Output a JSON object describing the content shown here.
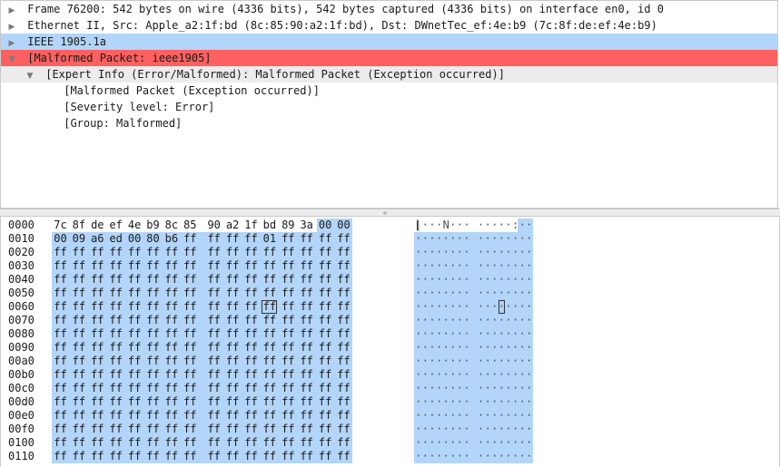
{
  "tree": [
    {
      "label": "Frame 76200: 542 bytes on wire (4336 bits), 542 bytes captured (4336 bits) on interface en0, id 0",
      "toggle": "▶",
      "indent": 0,
      "style": ""
    },
    {
      "label": "Ethernet II, Src: Apple_a2:1f:bd (8c:85:90:a2:1f:bd), Dst: DWnetTec_ef:4e:b9 (7c:8f:de:ef:4e:b9)",
      "toggle": "▶",
      "indent": 0,
      "style": ""
    },
    {
      "label": "IEEE 1905.1a",
      "toggle": "▶",
      "indent": 0,
      "style": "selected"
    },
    {
      "label": "[Malformed Packet: ieee1905]",
      "toggle": "▼",
      "indent": 0,
      "style": "error"
    },
    {
      "label": "[Expert Info (Error/Malformed): Malformed Packet (Exception occurred)]",
      "toggle": "▼",
      "indent": 1,
      "style": "expert"
    },
    {
      "label": "[Malformed Packet (Exception occurred)]",
      "toggle": "",
      "indent": 2,
      "style": ""
    },
    {
      "label": "[Severity level: Error]",
      "toggle": "",
      "indent": 2,
      "style": ""
    },
    {
      "label": "[Group: Malformed]",
      "toggle": "",
      "indent": 2,
      "style": ""
    }
  ],
  "hex_rows": [
    {
      "offset": "0000",
      "bytes": [
        "7c",
        "8f",
        "de",
        "ef",
        "4e",
        "b9",
        "8c",
        "85",
        "90",
        "a2",
        "1f",
        "bd",
        "89",
        "3a",
        "00",
        "00"
      ],
      "ascii": "|···N··· ·····:··"
    },
    {
      "offset": "0010",
      "bytes": [
        "00",
        "09",
        "a6",
        "ed",
        "00",
        "80",
        "b6",
        "ff",
        "ff",
        "ff",
        "ff",
        "01",
        "ff",
        "ff",
        "ff",
        "ff"
      ],
      "ascii": "········ ········"
    },
    {
      "offset": "0020",
      "bytes": [
        "ff",
        "ff",
        "ff",
        "ff",
        "ff",
        "ff",
        "ff",
        "ff",
        "ff",
        "ff",
        "ff",
        "ff",
        "ff",
        "ff",
        "ff",
        "ff"
      ],
      "ascii": "········ ········"
    },
    {
      "offset": "0030",
      "bytes": [
        "ff",
        "ff",
        "ff",
        "ff",
        "ff",
        "ff",
        "ff",
        "ff",
        "ff",
        "ff",
        "ff",
        "ff",
        "ff",
        "ff",
        "ff",
        "ff"
      ],
      "ascii": "········ ········"
    },
    {
      "offset": "0040",
      "bytes": [
        "ff",
        "ff",
        "ff",
        "ff",
        "ff",
        "ff",
        "ff",
        "ff",
        "ff",
        "ff",
        "ff",
        "ff",
        "ff",
        "ff",
        "ff",
        "ff"
      ],
      "ascii": "········ ········"
    },
    {
      "offset": "0050",
      "bytes": [
        "ff",
        "ff",
        "ff",
        "ff",
        "ff",
        "ff",
        "ff",
        "ff",
        "ff",
        "ff",
        "ff",
        "ff",
        "ff",
        "ff",
        "ff",
        "ff"
      ],
      "ascii": "········ ········"
    },
    {
      "offset": "0060",
      "bytes": [
        "ff",
        "ff",
        "ff",
        "ff",
        "ff",
        "ff",
        "ff",
        "ff",
        "ff",
        "ff",
        "ff",
        "ff",
        "ff",
        "ff",
        "ff",
        "ff"
      ],
      "ascii": "········ ········"
    },
    {
      "offset": "0070",
      "bytes": [
        "ff",
        "ff",
        "ff",
        "ff",
        "ff",
        "ff",
        "ff",
        "ff",
        "ff",
        "ff",
        "ff",
        "ff",
        "ff",
        "ff",
        "ff",
        "ff"
      ],
      "ascii": "········ ········"
    },
    {
      "offset": "0080",
      "bytes": [
        "ff",
        "ff",
        "ff",
        "ff",
        "ff",
        "ff",
        "ff",
        "ff",
        "ff",
        "ff",
        "ff",
        "ff",
        "ff",
        "ff",
        "ff",
        "ff"
      ],
      "ascii": "········ ········"
    },
    {
      "offset": "0090",
      "bytes": [
        "ff",
        "ff",
        "ff",
        "ff",
        "ff",
        "ff",
        "ff",
        "ff",
        "ff",
        "ff",
        "ff",
        "ff",
        "ff",
        "ff",
        "ff",
        "ff"
      ],
      "ascii": "········ ········"
    },
    {
      "offset": "00a0",
      "bytes": [
        "ff",
        "ff",
        "ff",
        "ff",
        "ff",
        "ff",
        "ff",
        "ff",
        "ff",
        "ff",
        "ff",
        "ff",
        "ff",
        "ff",
        "ff",
        "ff"
      ],
      "ascii": "········ ········"
    },
    {
      "offset": "00b0",
      "bytes": [
        "ff",
        "ff",
        "ff",
        "ff",
        "ff",
        "ff",
        "ff",
        "ff",
        "ff",
        "ff",
        "ff",
        "ff",
        "ff",
        "ff",
        "ff",
        "ff"
      ],
      "ascii": "········ ········"
    },
    {
      "offset": "00c0",
      "bytes": [
        "ff",
        "ff",
        "ff",
        "ff",
        "ff",
        "ff",
        "ff",
        "ff",
        "ff",
        "ff",
        "ff",
        "ff",
        "ff",
        "ff",
        "ff",
        "ff"
      ],
      "ascii": "········ ········"
    },
    {
      "offset": "00d0",
      "bytes": [
        "ff",
        "ff",
        "ff",
        "ff",
        "ff",
        "ff",
        "ff",
        "ff",
        "ff",
        "ff",
        "ff",
        "ff",
        "ff",
        "ff",
        "ff",
        "ff"
      ],
      "ascii": "········ ········"
    },
    {
      "offset": "00e0",
      "bytes": [
        "ff",
        "ff",
        "ff",
        "ff",
        "ff",
        "ff",
        "ff",
        "ff",
        "ff",
        "ff",
        "ff",
        "ff",
        "ff",
        "ff",
        "ff",
        "ff"
      ],
      "ascii": "········ ········"
    },
    {
      "offset": "00f0",
      "bytes": [
        "ff",
        "ff",
        "ff",
        "ff",
        "ff",
        "ff",
        "ff",
        "ff",
        "ff",
        "ff",
        "ff",
        "ff",
        "ff",
        "ff",
        "ff",
        "ff"
      ],
      "ascii": "········ ········"
    },
    {
      "offset": "0100",
      "bytes": [
        "ff",
        "ff",
        "ff",
        "ff",
        "ff",
        "ff",
        "ff",
        "ff",
        "ff",
        "ff",
        "ff",
        "ff",
        "ff",
        "ff",
        "ff",
        "ff"
      ],
      "ascii": "········ ········"
    },
    {
      "offset": "0110",
      "bytes": [
        "ff",
        "ff",
        "ff",
        "ff",
        "ff",
        "ff",
        "ff",
        "ff",
        "ff",
        "ff",
        "ff",
        "ff",
        "ff",
        "ff",
        "ff",
        "ff"
      ],
      "ascii": "········ ········"
    }
  ],
  "boxed_byte": {
    "row": 6,
    "col": 11
  },
  "colors": {
    "selection": "#b2d5f9",
    "error": "#fd6060",
    "expert": "#ececec"
  }
}
